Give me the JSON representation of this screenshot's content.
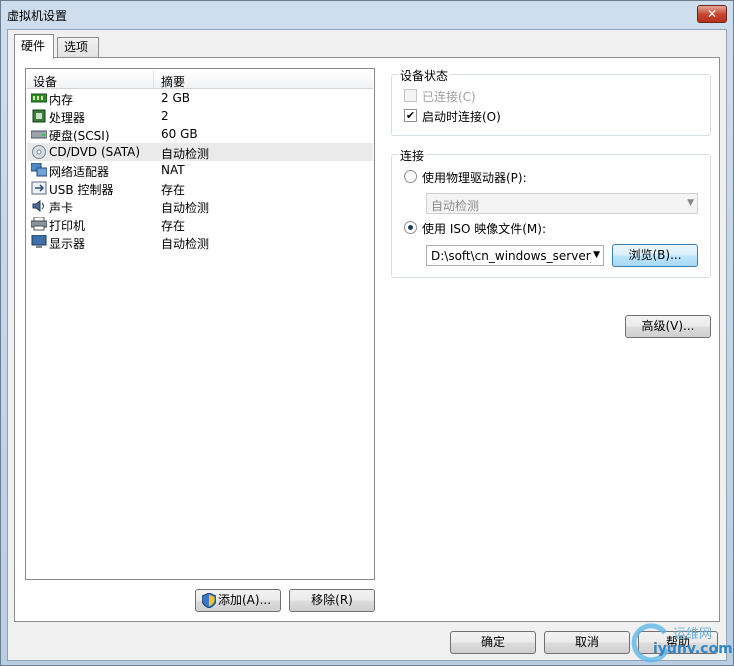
{
  "window": {
    "title": "虚拟机设置",
    "close": "✕"
  },
  "tabs": [
    {
      "label": "硬件"
    },
    {
      "label": "选项"
    }
  ],
  "device_list": {
    "headers": {
      "device": "设备",
      "summary": "摘要"
    },
    "rows": [
      {
        "name": "内存",
        "summary": "2 GB",
        "icon": "memory-icon"
      },
      {
        "name": "处理器",
        "summary": "2",
        "icon": "processor-icon"
      },
      {
        "name": "硬盘(SCSI)",
        "summary": "60 GB",
        "icon": "harddisk-icon"
      },
      {
        "name": "CD/DVD (SATA)",
        "summary": "自动检测",
        "icon": "cd-dvd-icon"
      },
      {
        "name": "网络适配器",
        "summary": "NAT",
        "icon": "network-adapter-icon"
      },
      {
        "name": "USB 控制器",
        "summary": "存在",
        "icon": "usb-icon"
      },
      {
        "name": "声卡",
        "summary": "自动检测",
        "icon": "sound-card-icon"
      },
      {
        "name": "打印机",
        "summary": "存在",
        "icon": "printer-icon"
      },
      {
        "name": "显示器",
        "summary": "自动检测",
        "icon": "display-icon"
      }
    ],
    "selected_index": 3
  },
  "buttons": {
    "add": "添加(A)...",
    "remove": "移除(R)",
    "ok": "确定",
    "cancel": "取消",
    "help": "帮助",
    "advanced": "高级(V)...",
    "browse": "浏览(B)..."
  },
  "device_status": {
    "title": "设备状态",
    "connected": {
      "label": "已连接(C)",
      "checked": false,
      "disabled": true
    },
    "connect_at_power_on": {
      "label": "启动时连接(O)",
      "checked": true
    }
  },
  "connection": {
    "title": "连接",
    "physical_drive": {
      "label": "使用物理驱动器(P):",
      "selected": false,
      "value": "自动检测"
    },
    "iso_image": {
      "label": "使用 ISO 映像文件(M):",
      "selected": true,
      "path": "D:\\soft\\cn_windows_server_"
    }
  },
  "watermark": {
    "line1": "运维网",
    "line2": "iyunv.com"
  }
}
